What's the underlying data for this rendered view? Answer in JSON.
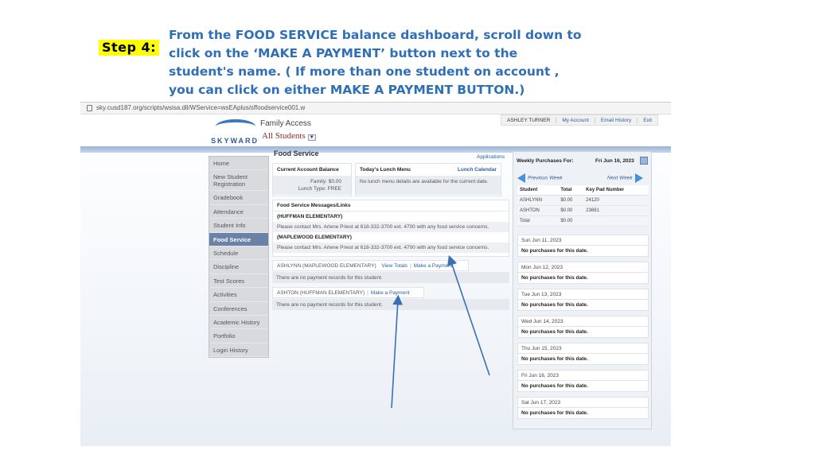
{
  "slide": {
    "step_label": "Step 4:",
    "instruction": "From the FOOD SERVICE balance dashboard, scroll down to click on the ‘MAKE A PAYMENT’ button next to the student's name. ( If more than one student on account , you can click on either MAKE A PAYMENT BUTTON.)"
  },
  "browser": {
    "url": "sky.cusd187.org/scripts/wsisa.dll/WService=wsEAplus/sffoodservice001.w"
  },
  "header": {
    "logo_text": "SKYWARD",
    "product": "Family Access",
    "student_selector": "All Students",
    "user_name": "ASHLEY TURNER",
    "links": [
      "My Account",
      "Email History",
      "Exit"
    ]
  },
  "sidebar": {
    "items": [
      {
        "label": "Home"
      },
      {
        "label": "New Student Registration"
      },
      {
        "label": "Gradebook"
      },
      {
        "label": "Attendance"
      },
      {
        "label": "Student Info"
      },
      {
        "label": "Food Service",
        "active": true
      },
      {
        "label": "Schedule"
      },
      {
        "label": "Discipline"
      },
      {
        "label": "Test Scores"
      },
      {
        "label": "Activities"
      },
      {
        "label": "Conferences"
      },
      {
        "label": "Academic History"
      },
      {
        "label": "Portfolio"
      },
      {
        "label": "Login History"
      }
    ]
  },
  "main": {
    "title": "Food Service",
    "applications_link": "Applications",
    "balance": {
      "heading": "Current Account Balance",
      "family_label": "Family:",
      "family_value": "$0.00",
      "lunch_type_label": "Lunch Type:",
      "lunch_type_value": "FREE"
    },
    "lunch_menu": {
      "heading": "Today's Lunch Menu",
      "calendar_link": "Lunch Calendar",
      "text": "No lunch menu details are available for the current date."
    },
    "messages": {
      "heading": "Food Service Messages/Links",
      "schools": [
        {
          "name": "(HUFFMAN ELEMENTARY)",
          "text": "Please contact Mrs. Arlene Priest at 618-332-3700 ext. 4700 with any food service concerns."
        },
        {
          "name": "(MAPLEWOOD ELEMENTARY)",
          "text": "Please contact Mrs. Arlene Priest at 618-332-3700 ext. 4700 with any food service concerns."
        }
      ]
    },
    "students": [
      {
        "name": "ASHLYNN (MAPLEWOOD ELEMENTARY)",
        "view_totals": "View Totals",
        "make_payment": "Make a Payment",
        "no_records": "There are no payment records for this student."
      },
      {
        "name": "ASHTON (HUFFMAN ELEMENTARY)",
        "make_payment": "Make a Payment",
        "no_records": "There are no payment records for this student."
      }
    ]
  },
  "weekly": {
    "title": "Weekly Purchases For:",
    "date": "Fri Jun 16, 2023",
    "prev_week": "Previous Week",
    "next_week": "Next Week",
    "columns": [
      "Student",
      "Total",
      "Key Pad Number"
    ],
    "rows": [
      [
        "ASHLYNN",
        "$0.00",
        "24120"
      ],
      [
        "ASHTON",
        "$0.00",
        "23691"
      ],
      [
        "Total",
        "$0.00",
        ""
      ]
    ],
    "days": [
      {
        "date": "Sun Jun 11, 2023",
        "text": "No purchases for this date."
      },
      {
        "date": "Mon Jun 12, 2023",
        "text": "No purchases for this date."
      },
      {
        "date": "Tue Jun 13, 2023",
        "text": "No purchases for this date."
      },
      {
        "date": "Wed Jun 14, 2023",
        "text": "No purchases for this date."
      },
      {
        "date": "Thu Jun 15, 2023",
        "text": "No purchases for this date."
      },
      {
        "date": "Fri Jun 16, 2023",
        "text": "No purchases for this date."
      },
      {
        "date": "Sat Jun 17, 2023",
        "text": "No purchases for this date."
      }
    ]
  },
  "colors": {
    "instruction_text": "#2e6fb7",
    "step_highlight": "#ffff00",
    "active_nav": "#6a82a8",
    "link": "#2a5fa3",
    "annotation_arrow": "#3a6fb5"
  }
}
